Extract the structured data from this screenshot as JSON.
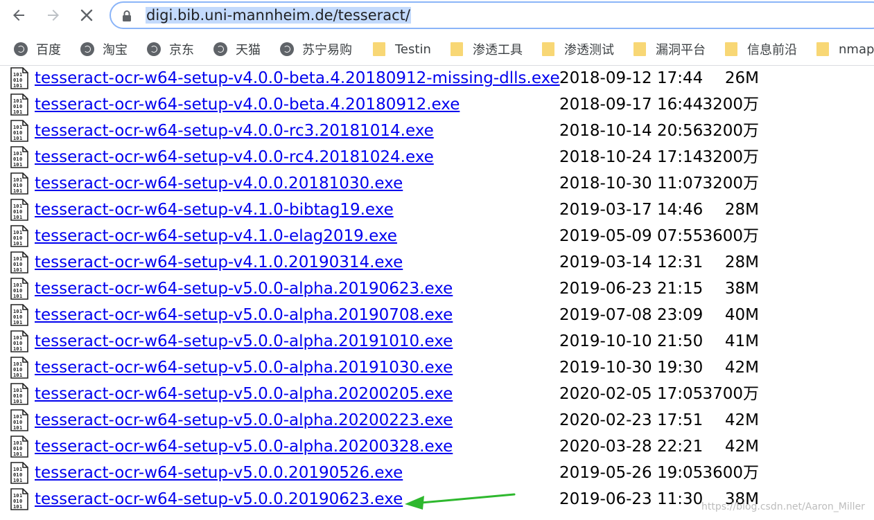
{
  "browser": {
    "url": "digi.bib.uni-mannheim.de/tesseract/",
    "back_icon": "back-arrow-icon",
    "forward_icon": "forward-arrow-icon",
    "stop_icon": "stop-loading-icon",
    "lock_icon": "lock-icon"
  },
  "bookmarks": [
    {
      "label": "百度",
      "icon": "globe-icon"
    },
    {
      "label": "淘宝",
      "icon": "globe-icon"
    },
    {
      "label": "京东",
      "icon": "globe-icon"
    },
    {
      "label": "天猫",
      "icon": "globe-icon"
    },
    {
      "label": "苏宁易购",
      "icon": "globe-icon"
    },
    {
      "label": "Testin",
      "icon": "folder-icon"
    },
    {
      "label": "渗透工具",
      "icon": "folder-icon"
    },
    {
      "label": "渗透测试",
      "icon": "folder-icon"
    },
    {
      "label": "漏洞平台",
      "icon": "folder-icon"
    },
    {
      "label": "信息前沿",
      "icon": "folder-icon"
    },
    {
      "label": "nmap",
      "icon": "folder-icon"
    }
  ],
  "files": [
    {
      "name": "tesseract-ocr-w64-setup-v4.0.0-beta.4.20180912-missing-dlls.exe",
      "date": "2018-09-12 17:44",
      "size": "26M"
    },
    {
      "name": "tesseract-ocr-w64-setup-v4.0.0-beta.4.20180912.exe",
      "date": "2018-09-17 16:44",
      "size": "3200万"
    },
    {
      "name": "tesseract-ocr-w64-setup-v4.0.0-rc3.20181014.exe",
      "date": "2018-10-14 20:56",
      "size": "3200万"
    },
    {
      "name": "tesseract-ocr-w64-setup-v4.0.0-rc4.20181024.exe",
      "date": "2018-10-24 17:14",
      "size": "3200万"
    },
    {
      "name": "tesseract-ocr-w64-setup-v4.0.0.20181030.exe",
      "date": "2018-10-30 11:07",
      "size": "3200万"
    },
    {
      "name": "tesseract-ocr-w64-setup-v4.1.0-bibtag19.exe",
      "date": "2019-03-17 14:46",
      "size": "28M"
    },
    {
      "name": "tesseract-ocr-w64-setup-v4.1.0-elag2019.exe",
      "date": "2019-05-09 07:55",
      "size": "3600万"
    },
    {
      "name": "tesseract-ocr-w64-setup-v4.1.0.20190314.exe",
      "date": "2019-03-14 12:31",
      "size": "28M"
    },
    {
      "name": "tesseract-ocr-w64-setup-v5.0.0-alpha.20190623.exe",
      "date": "2019-06-23 21:15",
      "size": "38M"
    },
    {
      "name": "tesseract-ocr-w64-setup-v5.0.0-alpha.20190708.exe",
      "date": "2019-07-08 23:09",
      "size": "40M"
    },
    {
      "name": "tesseract-ocr-w64-setup-v5.0.0-alpha.20191010.exe",
      "date": "2019-10-10 21:50",
      "size": "41M"
    },
    {
      "name": "tesseract-ocr-w64-setup-v5.0.0-alpha.20191030.exe",
      "date": "2019-10-30 19:30",
      "size": "42M"
    },
    {
      "name": "tesseract-ocr-w64-setup-v5.0.0-alpha.20200205.exe",
      "date": "2020-02-05 17:05",
      "size": "3700万"
    },
    {
      "name": "tesseract-ocr-w64-setup-v5.0.0-alpha.20200223.exe",
      "date": "2020-02-23 17:51",
      "size": "42M"
    },
    {
      "name": "tesseract-ocr-w64-setup-v5.0.0-alpha.20200328.exe",
      "date": "2020-03-28 22:21",
      "size": "42M"
    },
    {
      "name": "tesseract-ocr-w64-setup-v5.0.0.20190526.exe",
      "date": "2019-05-26 19:05",
      "size": "3600万"
    },
    {
      "name": "tesseract-ocr-w64-setup-v5.0.0.20190623.exe",
      "date": "2019-06-23 11:30",
      "size": "38M"
    }
  ],
  "annotation": {
    "arrow_color": "#2eb82e",
    "arrow_icon": "green-arrow-icon"
  },
  "watermark": "https://blog.csdn.net/Aaron_Miller",
  "colors": {
    "link": "#0000ee",
    "url_highlight": "#c3dafc",
    "omnibox_border": "#8ab4f8",
    "folder": "#f8d775"
  }
}
